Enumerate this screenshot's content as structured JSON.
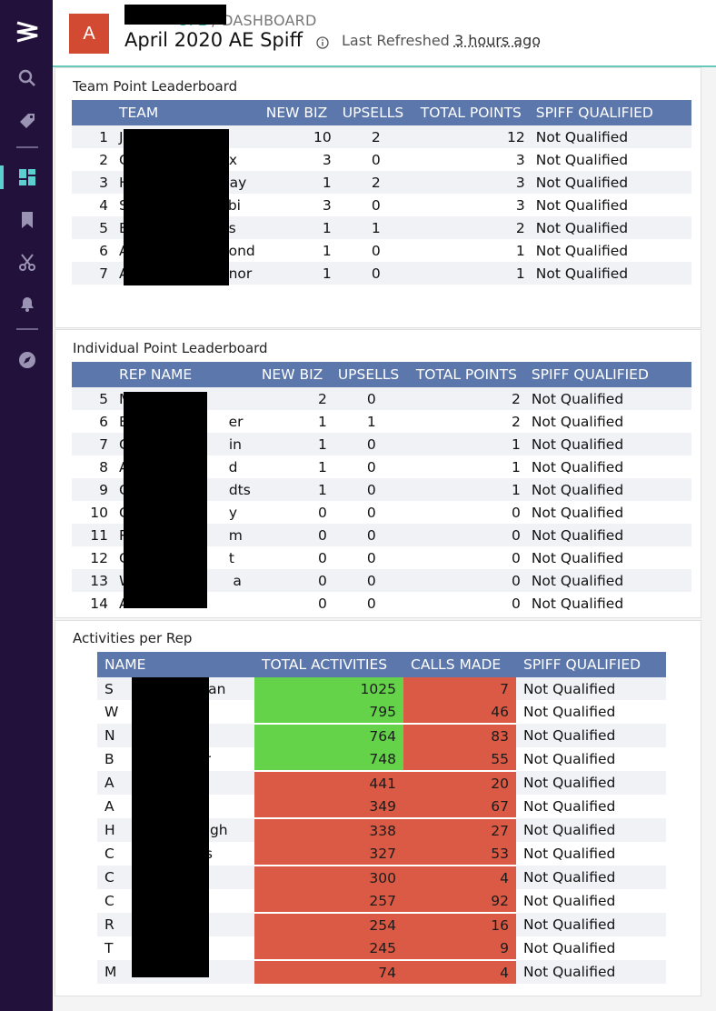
{
  "header": {
    "avatar_letter": "A",
    "breadcrumb_link": "OPE",
    "breadcrumb_sep": " / ",
    "breadcrumb_current": "DASHBOARD",
    "title": "April 2020 AE Spiff",
    "refresh_label": "Last Refreshed",
    "refresh_ago": "3 hours ago"
  },
  "sidebar": {
    "icons": [
      "logo-icon",
      "search-icon",
      "tag-icon",
      "dashboard-icon",
      "bookmark-icon",
      "scissors-icon",
      "bell-icon",
      "compass-icon"
    ],
    "active_accent": "#5ccfd0",
    "background": "#22123b"
  },
  "team_leaderboard": {
    "title": "Team Point Leaderboard",
    "columns": [
      "TEAM",
      "NEW BIZ",
      "UPSELLS",
      "TOTAL POINTS",
      "SPIFF QUALIFIED"
    ],
    "rows": [
      {
        "rank": "1",
        "name": "J",
        "new_biz": "10",
        "upsells": "2",
        "total": "12",
        "qualified": "Not Qualified"
      },
      {
        "rank": "2",
        "name": "C",
        "name_tail": "x",
        "new_biz": "3",
        "upsells": "0",
        "total": "3",
        "qualified": "Not Qualified"
      },
      {
        "rank": "3",
        "name": "H",
        "name_tail": "ay",
        "new_biz": "1",
        "upsells": "2",
        "total": "3",
        "qualified": "Not Qualified"
      },
      {
        "rank": "4",
        "name": "S",
        "name_tail": "bi",
        "new_biz": "3",
        "upsells": "0",
        "total": "3",
        "qualified": "Not Qualified"
      },
      {
        "rank": "5",
        "name": "B",
        "name_tail": "s",
        "new_biz": "1",
        "upsells": "1",
        "total": "2",
        "qualified": "Not Qualified"
      },
      {
        "rank": "6",
        "name": "A",
        "name_tail": "ond",
        "new_biz": "1",
        "upsells": "0",
        "total": "1",
        "qualified": "Not Qualified"
      },
      {
        "rank": "7",
        "name": "A",
        "name_tail": "nor",
        "new_biz": "1",
        "upsells": "0",
        "total": "1",
        "qualified": "Not Qualified"
      }
    ]
  },
  "individual_leaderboard": {
    "title": "Individual Point Leaderboard",
    "columns": [
      "REP NAME",
      "NEW BIZ",
      "UPSELLS",
      "TOTAL POINTS",
      "SPIFF QUALIFIED"
    ],
    "rows": [
      {
        "rank": "5",
        "name": "M",
        "name_tail": "",
        "new_biz": "2",
        "upsells": "0",
        "total": "2",
        "qualified": "Not Qualified"
      },
      {
        "rank": "6",
        "name": "B",
        "name_tail": "er",
        "new_biz": "1",
        "upsells": "1",
        "total": "2",
        "qualified": "Not Qualified"
      },
      {
        "rank": "7",
        "name": "C",
        "name_tail": "in",
        "new_biz": "1",
        "upsells": "0",
        "total": "1",
        "qualified": "Not Qualified"
      },
      {
        "rank": "8",
        "name": "A",
        "name_tail": "d",
        "new_biz": "1",
        "upsells": "0",
        "total": "1",
        "qualified": "Not Qualified"
      },
      {
        "rank": "9",
        "name": "C",
        "name_tail": "dts",
        "new_biz": "1",
        "upsells": "0",
        "total": "1",
        "qualified": "Not Qualified"
      },
      {
        "rank": "10",
        "name": "C",
        "name_tail": "y",
        "new_biz": "0",
        "upsells": "0",
        "total": "0",
        "qualified": "Not Qualified"
      },
      {
        "rank": "11",
        "name": "R",
        "name_tail": "m",
        "new_biz": "0",
        "upsells": "0",
        "total": "0",
        "qualified": "Not Qualified"
      },
      {
        "rank": "12",
        "name": "C",
        "name_tail": "t",
        "new_biz": "0",
        "upsells": "0",
        "total": "0",
        "qualified": "Not Qualified"
      },
      {
        "rank": "13",
        "name": "W",
        "name_tail": "a",
        "new_biz": "0",
        "upsells": "0",
        "total": "0",
        "qualified": "Not Qualified"
      },
      {
        "rank": "14",
        "name": "A",
        "name_tail": "",
        "new_biz": "0",
        "upsells": "0",
        "total": "0",
        "qualified": "Not Qualified"
      }
    ]
  },
  "activities": {
    "title": "Activities per Rep",
    "columns": [
      "NAME",
      "TOTAL ACTIVITIES",
      "CALLS MADE",
      "SPIFF QUALIFIED"
    ],
    "colors": {
      "good": "#64d34a",
      "bad": "#db5a45",
      "header": "#5c77ab"
    },
    "rows": [
      {
        "name": "S",
        "name_tail": "ian",
        "total": "1025",
        "total_status": "good",
        "calls": "7",
        "qualified": "Not Qualified"
      },
      {
        "name": "W",
        "name_tail": "",
        "total": "795",
        "total_status": "good",
        "calls": "46",
        "qualified": "Not Qualified"
      },
      {
        "name": "N",
        "name_tail": "",
        "total": "764",
        "total_status": "good",
        "calls": "83",
        "qualified": "Not Qualified"
      },
      {
        "name": "B",
        "name_tail": "r",
        "total": "748",
        "total_status": "good",
        "calls": "55",
        "qualified": "Not Qualified"
      },
      {
        "name": "A",
        "name_tail": "",
        "total": "441",
        "total_status": "bad",
        "calls": "20",
        "qualified": "Not Qualified"
      },
      {
        "name": "A",
        "name_tail": "",
        "total": "349",
        "total_status": "bad",
        "calls": "67",
        "qualified": "Not Qualified"
      },
      {
        "name": "H",
        "name_tail": "igh",
        "total": "338",
        "total_status": "bad",
        "calls": "27",
        "qualified": "Not Qualified"
      },
      {
        "name": "C",
        "name_tail": "s",
        "total": "327",
        "total_status": "bad",
        "calls": "53",
        "qualified": "Not Qualified"
      },
      {
        "name": "C",
        "name_tail": "",
        "total": "300",
        "total_status": "bad",
        "calls": "4",
        "qualified": "Not Qualified"
      },
      {
        "name": "C",
        "name_tail": "",
        "total": "257",
        "total_status": "bad",
        "calls": "92",
        "qualified": "Not Qualified"
      },
      {
        "name": "R",
        "name_tail": "",
        "total": "254",
        "total_status": "bad",
        "calls": "16",
        "qualified": "Not Qualified"
      },
      {
        "name": "T",
        "name_tail": "",
        "total": "245",
        "total_status": "bad",
        "calls": "9",
        "qualified": "Not Qualified"
      },
      {
        "name": "M",
        "name_tail": "",
        "total": "74",
        "total_status": "bad",
        "calls": "4",
        "qualified": "Not Qualified"
      }
    ]
  }
}
